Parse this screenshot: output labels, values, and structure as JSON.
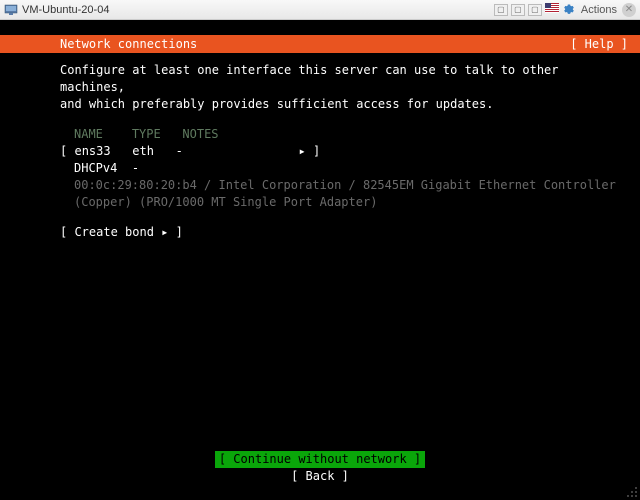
{
  "window": {
    "title": "VM-Ubuntu-20-04",
    "actions_label": "Actions"
  },
  "header": {
    "title": "Network connections",
    "help": "[ Help ]"
  },
  "instructions": {
    "line1": "Configure at least one interface this server can use to talk to other machines,",
    "line2": "and which preferably provides sufficient access for updates."
  },
  "table": {
    "headers": {
      "name": "NAME",
      "type": "TYPE",
      "notes": "NOTES"
    },
    "row": {
      "bracket_open": "[",
      "name": "ens33",
      "type": "eth",
      "notes": "-",
      "arrow": "▸",
      "bracket_close": "]"
    },
    "dhcp": {
      "label": "DHCPv4",
      "status": "-"
    },
    "hw": {
      "line1": "00:0c:29:80:20:b4 / Intel Corporation / 82545EM Gigabit Ethernet Controller",
      "line2": "(Copper) (PRO/1000 MT Single Port Adapter)"
    }
  },
  "create_bond": "[ Create bond ▸ ]",
  "buttons": {
    "continue": "[ Continue without network ]",
    "back": "[ Back                     ]"
  }
}
